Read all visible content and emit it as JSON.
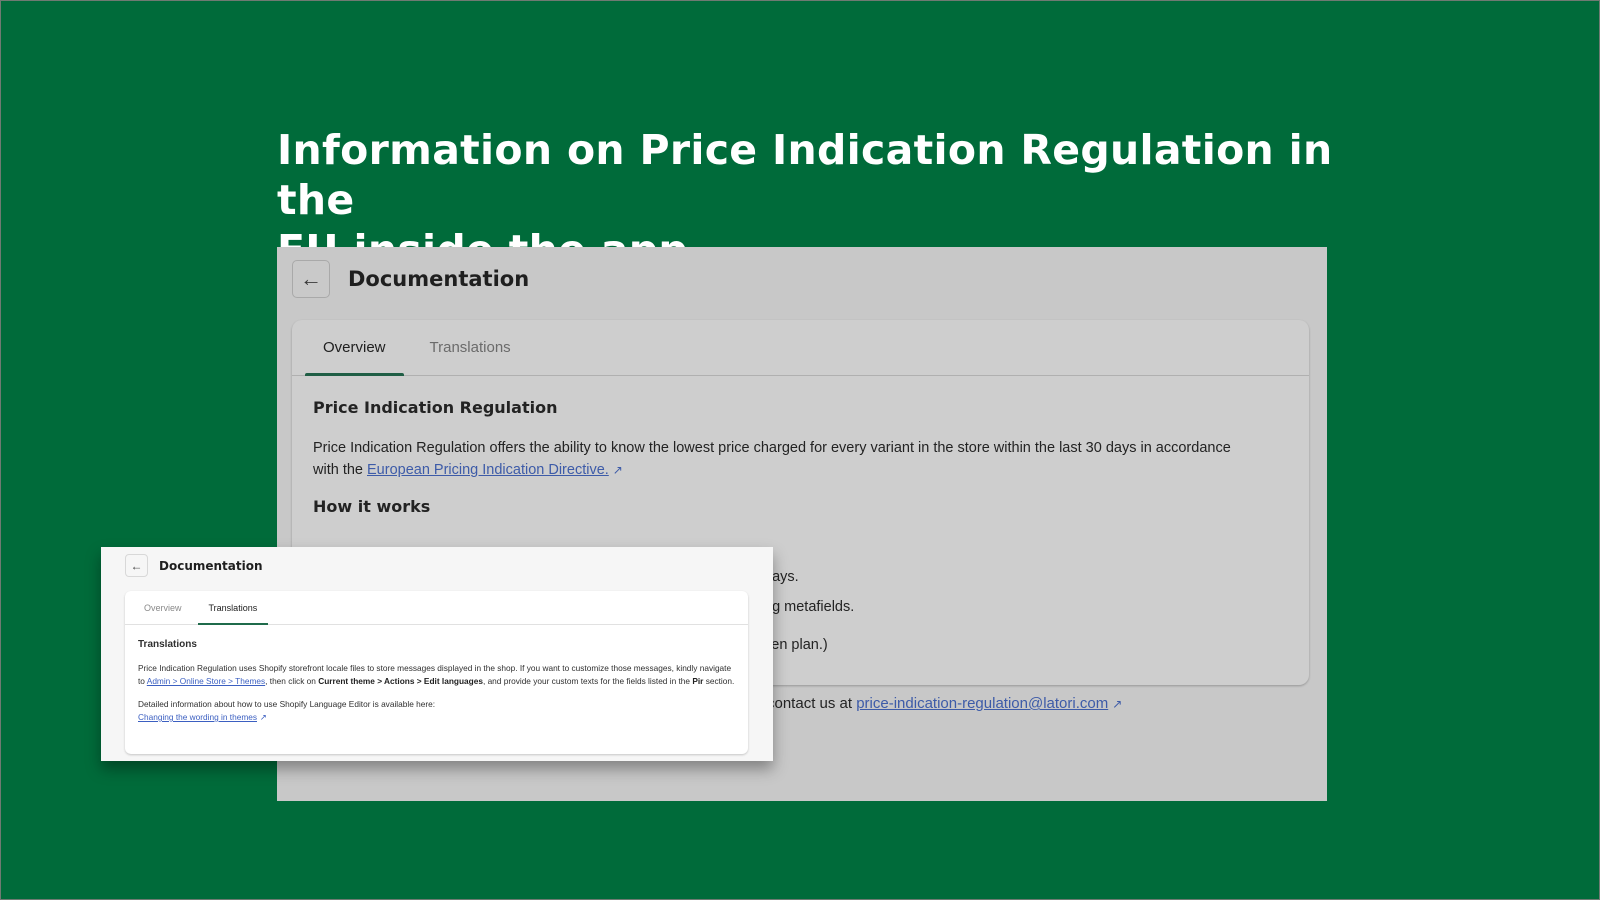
{
  "headline": {
    "line1": "Information on Price Indication Regulation in the",
    "line2": "EU inside the app."
  },
  "main_page": {
    "back_icon": "arrow-left-icon",
    "title": "Documentation",
    "tabs": [
      {
        "label": "Overview",
        "active": true
      },
      {
        "label": "Translations",
        "active": false
      }
    ],
    "section_title": "Price Indication Regulation",
    "description_text": "Price Indication Regulation offers the ability to know the lowest price charged for every variant in the store within the last 30 days in accordance with the ",
    "directive_link": "European Pricing Indication Directive.",
    "how_it_works_title": "How it works",
    "visible_fragments": [
      "days.",
      "ng metafields.",
      "sen plan.)"
    ],
    "contact_prefix": "contact us at ",
    "contact_email": "price-indication-regulation@latori.com"
  },
  "overlay_page": {
    "back_icon": "arrow-left-icon",
    "title": "Documentation",
    "tabs": [
      {
        "label": "Overview",
        "active": false
      },
      {
        "label": "Translations",
        "active": true
      }
    ],
    "section_title": "Translations",
    "para1_a": "Price Indication Regulation uses Shopify storefront locale files to store messages displayed in the shop. If you want to customize those messages, kindly navigate to ",
    "para1_link": "Admin > Online Store > Themes",
    "para1_b": ", then click on ",
    "para1_bold": "Current theme > Actions > Edit languages",
    "para1_c": ", and provide your custom texts for the fields listed in the ",
    "para1_bold2": "Pir",
    "para1_d": " section.",
    "para2": "Detailed information about how to use Shopify Language Editor is available here:",
    "para2_link": "Changing the wording in themes"
  },
  "colors": {
    "background": "#006b3a",
    "link": "#3d5ba8",
    "tab_indicator": "#1f5e45"
  }
}
